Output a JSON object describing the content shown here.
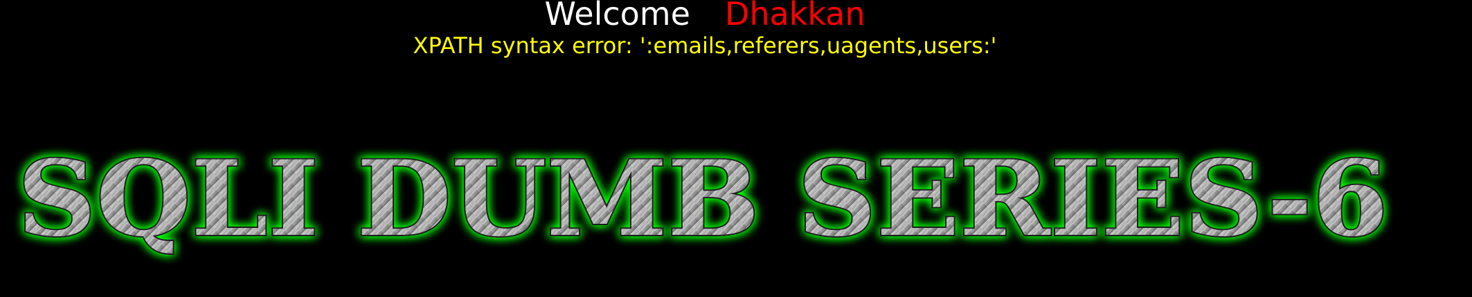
{
  "login": {
    "welcome_label": "Welcome",
    "user_name": "Dhakkan"
  },
  "error": {
    "message": "XPATH syntax error: ':emails,referers,uagents,users:'"
  },
  "banner": {
    "title": "SQLI DUMB SERIES-6"
  },
  "colors": {
    "background": "#000000",
    "welcome_text": "#ffffff",
    "user_name": "#ff0000",
    "error_text": "#ffff00",
    "banner_glow": "#00ff00",
    "banner_metal": "#9a9a9a"
  }
}
